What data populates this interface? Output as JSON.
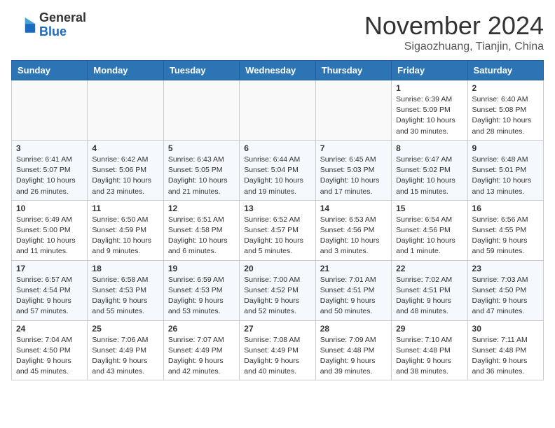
{
  "header": {
    "logo_line1": "General",
    "logo_line2": "Blue",
    "month": "November 2024",
    "location": "Sigaozhuang, Tianjin, China"
  },
  "weekdays": [
    "Sunday",
    "Monday",
    "Tuesday",
    "Wednesday",
    "Thursday",
    "Friday",
    "Saturday"
  ],
  "weeks": [
    [
      {
        "day": "",
        "info": ""
      },
      {
        "day": "",
        "info": ""
      },
      {
        "day": "",
        "info": ""
      },
      {
        "day": "",
        "info": ""
      },
      {
        "day": "",
        "info": ""
      },
      {
        "day": "1",
        "info": "Sunrise: 6:39 AM\nSunset: 5:09 PM\nDaylight: 10 hours and 30 minutes."
      },
      {
        "day": "2",
        "info": "Sunrise: 6:40 AM\nSunset: 5:08 PM\nDaylight: 10 hours and 28 minutes."
      }
    ],
    [
      {
        "day": "3",
        "info": "Sunrise: 6:41 AM\nSunset: 5:07 PM\nDaylight: 10 hours and 26 minutes."
      },
      {
        "day": "4",
        "info": "Sunrise: 6:42 AM\nSunset: 5:06 PM\nDaylight: 10 hours and 23 minutes."
      },
      {
        "day": "5",
        "info": "Sunrise: 6:43 AM\nSunset: 5:05 PM\nDaylight: 10 hours and 21 minutes."
      },
      {
        "day": "6",
        "info": "Sunrise: 6:44 AM\nSunset: 5:04 PM\nDaylight: 10 hours and 19 minutes."
      },
      {
        "day": "7",
        "info": "Sunrise: 6:45 AM\nSunset: 5:03 PM\nDaylight: 10 hours and 17 minutes."
      },
      {
        "day": "8",
        "info": "Sunrise: 6:47 AM\nSunset: 5:02 PM\nDaylight: 10 hours and 15 minutes."
      },
      {
        "day": "9",
        "info": "Sunrise: 6:48 AM\nSunset: 5:01 PM\nDaylight: 10 hours and 13 minutes."
      }
    ],
    [
      {
        "day": "10",
        "info": "Sunrise: 6:49 AM\nSunset: 5:00 PM\nDaylight: 10 hours and 11 minutes."
      },
      {
        "day": "11",
        "info": "Sunrise: 6:50 AM\nSunset: 4:59 PM\nDaylight: 10 hours and 9 minutes."
      },
      {
        "day": "12",
        "info": "Sunrise: 6:51 AM\nSunset: 4:58 PM\nDaylight: 10 hours and 6 minutes."
      },
      {
        "day": "13",
        "info": "Sunrise: 6:52 AM\nSunset: 4:57 PM\nDaylight: 10 hours and 5 minutes."
      },
      {
        "day": "14",
        "info": "Sunrise: 6:53 AM\nSunset: 4:56 PM\nDaylight: 10 hours and 3 minutes."
      },
      {
        "day": "15",
        "info": "Sunrise: 6:54 AM\nSunset: 4:56 PM\nDaylight: 10 hours and 1 minute."
      },
      {
        "day": "16",
        "info": "Sunrise: 6:56 AM\nSunset: 4:55 PM\nDaylight: 9 hours and 59 minutes."
      }
    ],
    [
      {
        "day": "17",
        "info": "Sunrise: 6:57 AM\nSunset: 4:54 PM\nDaylight: 9 hours and 57 minutes."
      },
      {
        "day": "18",
        "info": "Sunrise: 6:58 AM\nSunset: 4:53 PM\nDaylight: 9 hours and 55 minutes."
      },
      {
        "day": "19",
        "info": "Sunrise: 6:59 AM\nSunset: 4:53 PM\nDaylight: 9 hours and 53 minutes."
      },
      {
        "day": "20",
        "info": "Sunrise: 7:00 AM\nSunset: 4:52 PM\nDaylight: 9 hours and 52 minutes."
      },
      {
        "day": "21",
        "info": "Sunrise: 7:01 AM\nSunset: 4:51 PM\nDaylight: 9 hours and 50 minutes."
      },
      {
        "day": "22",
        "info": "Sunrise: 7:02 AM\nSunset: 4:51 PM\nDaylight: 9 hours and 48 minutes."
      },
      {
        "day": "23",
        "info": "Sunrise: 7:03 AM\nSunset: 4:50 PM\nDaylight: 9 hours and 47 minutes."
      }
    ],
    [
      {
        "day": "24",
        "info": "Sunrise: 7:04 AM\nSunset: 4:50 PM\nDaylight: 9 hours and 45 minutes."
      },
      {
        "day": "25",
        "info": "Sunrise: 7:06 AM\nSunset: 4:49 PM\nDaylight: 9 hours and 43 minutes."
      },
      {
        "day": "26",
        "info": "Sunrise: 7:07 AM\nSunset: 4:49 PM\nDaylight: 9 hours and 42 minutes."
      },
      {
        "day": "27",
        "info": "Sunrise: 7:08 AM\nSunset: 4:49 PM\nDaylight: 9 hours and 40 minutes."
      },
      {
        "day": "28",
        "info": "Sunrise: 7:09 AM\nSunset: 4:48 PM\nDaylight: 9 hours and 39 minutes."
      },
      {
        "day": "29",
        "info": "Sunrise: 7:10 AM\nSunset: 4:48 PM\nDaylight: 9 hours and 38 minutes."
      },
      {
        "day": "30",
        "info": "Sunrise: 7:11 AM\nSunset: 4:48 PM\nDaylight: 9 hours and 36 minutes."
      }
    ]
  ]
}
